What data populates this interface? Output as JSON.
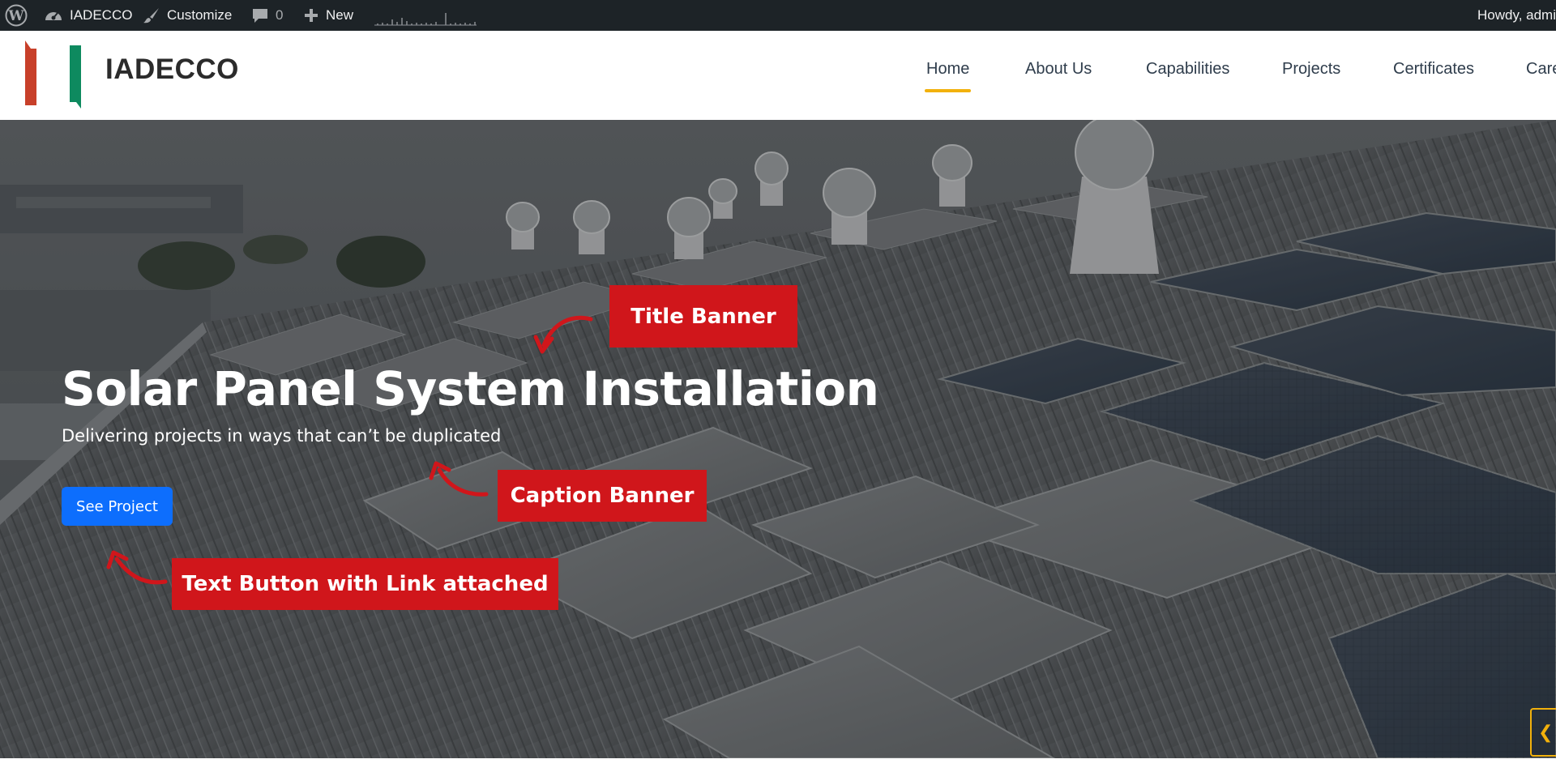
{
  "admin_bar": {
    "wp_logo_icon": "wordpress-icon",
    "site_name": "IADECCO",
    "customize": "Customize",
    "comments_count": "0",
    "new": "New",
    "howdy": "Howdy, admi"
  },
  "header": {
    "site_title": "IADECCO",
    "nav": [
      {
        "label": "Home"
      },
      {
        "label": "About Us"
      },
      {
        "label": "Capabilities"
      },
      {
        "label": "Projects"
      },
      {
        "label": "Certificates"
      },
      {
        "label": "Care"
      }
    ],
    "accent_color": "#f2b10c"
  },
  "hero": {
    "title": "Solar Panel System Installation",
    "caption": "Delivering projects in ways that can’t be duplicated",
    "button_label": "See Project",
    "button_color": "#0d6efd"
  },
  "annotations": {
    "title_banner": "Title Banner",
    "caption_banner": "Caption Banner",
    "button_banner": "Text Button with Link attached",
    "color": "#d0161b"
  }
}
